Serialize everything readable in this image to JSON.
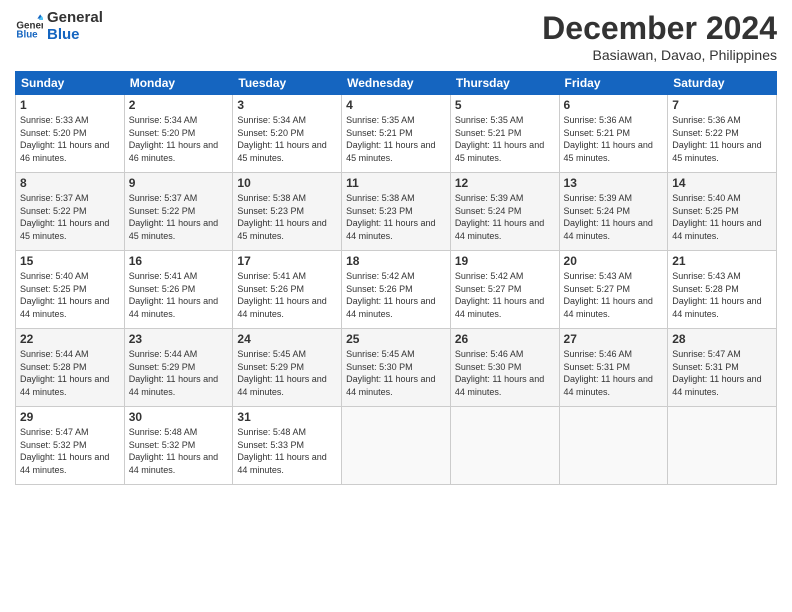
{
  "logo": {
    "line1": "General",
    "line2": "Blue"
  },
  "title": "December 2024",
  "location": "Basiawan, Davao, Philippines",
  "days_header": [
    "Sunday",
    "Monday",
    "Tuesday",
    "Wednesday",
    "Thursday",
    "Friday",
    "Saturday"
  ],
  "weeks": [
    [
      {
        "day": "1",
        "sunrise": "5:33 AM",
        "sunset": "5:20 PM",
        "daylight": "11 hours and 46 minutes."
      },
      {
        "day": "2",
        "sunrise": "5:34 AM",
        "sunset": "5:20 PM",
        "daylight": "11 hours and 46 minutes."
      },
      {
        "day": "3",
        "sunrise": "5:34 AM",
        "sunset": "5:20 PM",
        "daylight": "11 hours and 45 minutes."
      },
      {
        "day": "4",
        "sunrise": "5:35 AM",
        "sunset": "5:21 PM",
        "daylight": "11 hours and 45 minutes."
      },
      {
        "day": "5",
        "sunrise": "5:35 AM",
        "sunset": "5:21 PM",
        "daylight": "11 hours and 45 minutes."
      },
      {
        "day": "6",
        "sunrise": "5:36 AM",
        "sunset": "5:21 PM",
        "daylight": "11 hours and 45 minutes."
      },
      {
        "day": "7",
        "sunrise": "5:36 AM",
        "sunset": "5:22 PM",
        "daylight": "11 hours and 45 minutes."
      }
    ],
    [
      {
        "day": "8",
        "sunrise": "5:37 AM",
        "sunset": "5:22 PM",
        "daylight": "11 hours and 45 minutes."
      },
      {
        "day": "9",
        "sunrise": "5:37 AM",
        "sunset": "5:22 PM",
        "daylight": "11 hours and 45 minutes."
      },
      {
        "day": "10",
        "sunrise": "5:38 AM",
        "sunset": "5:23 PM",
        "daylight": "11 hours and 45 minutes."
      },
      {
        "day": "11",
        "sunrise": "5:38 AM",
        "sunset": "5:23 PM",
        "daylight": "11 hours and 44 minutes."
      },
      {
        "day": "12",
        "sunrise": "5:39 AM",
        "sunset": "5:24 PM",
        "daylight": "11 hours and 44 minutes."
      },
      {
        "day": "13",
        "sunrise": "5:39 AM",
        "sunset": "5:24 PM",
        "daylight": "11 hours and 44 minutes."
      },
      {
        "day": "14",
        "sunrise": "5:40 AM",
        "sunset": "5:25 PM",
        "daylight": "11 hours and 44 minutes."
      }
    ],
    [
      {
        "day": "15",
        "sunrise": "5:40 AM",
        "sunset": "5:25 PM",
        "daylight": "11 hours and 44 minutes."
      },
      {
        "day": "16",
        "sunrise": "5:41 AM",
        "sunset": "5:26 PM",
        "daylight": "11 hours and 44 minutes."
      },
      {
        "day": "17",
        "sunrise": "5:41 AM",
        "sunset": "5:26 PM",
        "daylight": "11 hours and 44 minutes."
      },
      {
        "day": "18",
        "sunrise": "5:42 AM",
        "sunset": "5:26 PM",
        "daylight": "11 hours and 44 minutes."
      },
      {
        "day": "19",
        "sunrise": "5:42 AM",
        "sunset": "5:27 PM",
        "daylight": "11 hours and 44 minutes."
      },
      {
        "day": "20",
        "sunrise": "5:43 AM",
        "sunset": "5:27 PM",
        "daylight": "11 hours and 44 minutes."
      },
      {
        "day": "21",
        "sunrise": "5:43 AM",
        "sunset": "5:28 PM",
        "daylight": "11 hours and 44 minutes."
      }
    ],
    [
      {
        "day": "22",
        "sunrise": "5:44 AM",
        "sunset": "5:28 PM",
        "daylight": "11 hours and 44 minutes."
      },
      {
        "day": "23",
        "sunrise": "5:44 AM",
        "sunset": "5:29 PM",
        "daylight": "11 hours and 44 minutes."
      },
      {
        "day": "24",
        "sunrise": "5:45 AM",
        "sunset": "5:29 PM",
        "daylight": "11 hours and 44 minutes."
      },
      {
        "day": "25",
        "sunrise": "5:45 AM",
        "sunset": "5:30 PM",
        "daylight": "11 hours and 44 minutes."
      },
      {
        "day": "26",
        "sunrise": "5:46 AM",
        "sunset": "5:30 PM",
        "daylight": "11 hours and 44 minutes."
      },
      {
        "day": "27",
        "sunrise": "5:46 AM",
        "sunset": "5:31 PM",
        "daylight": "11 hours and 44 minutes."
      },
      {
        "day": "28",
        "sunrise": "5:47 AM",
        "sunset": "5:31 PM",
        "daylight": "11 hours and 44 minutes."
      }
    ],
    [
      {
        "day": "29",
        "sunrise": "5:47 AM",
        "sunset": "5:32 PM",
        "daylight": "11 hours and 44 minutes."
      },
      {
        "day": "30",
        "sunrise": "5:48 AM",
        "sunset": "5:32 PM",
        "daylight": "11 hours and 44 minutes."
      },
      {
        "day": "31",
        "sunrise": "5:48 AM",
        "sunset": "5:33 PM",
        "daylight": "11 hours and 44 minutes."
      },
      null,
      null,
      null,
      null
    ]
  ],
  "labels": {
    "sunrise": "Sunrise:",
    "sunset": "Sunset:",
    "daylight": "Daylight: "
  }
}
